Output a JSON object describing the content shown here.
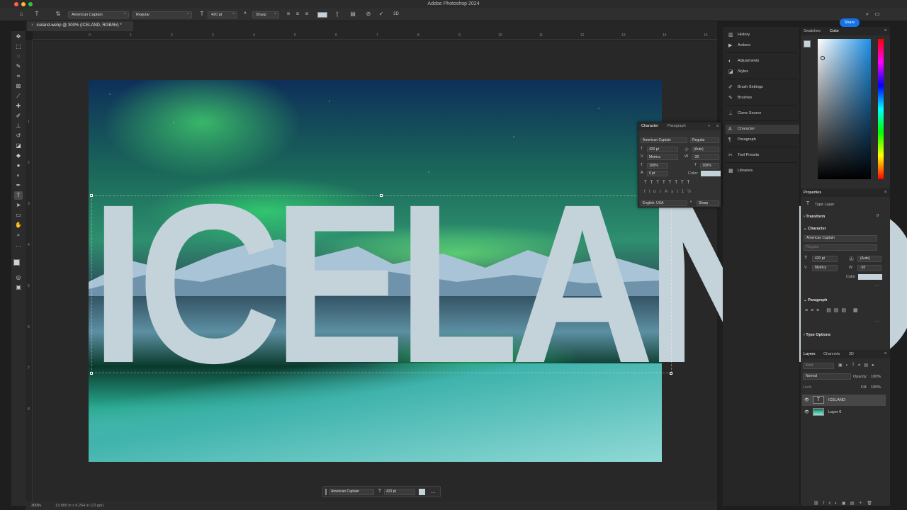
{
  "app": {
    "title": "Adobe Photoshop 2024",
    "share_label": "Share"
  },
  "options_bar": {
    "font_family": "American Captain",
    "font_style": "Regular",
    "font_size": "420 pt",
    "antialias": "Sharp"
  },
  "document": {
    "tab_label": "iceland.webp @ 300% (ICELAND, RGB/8#) *"
  },
  "canvas": {
    "text": "ICELAND"
  },
  "rulers": {
    "h": [
      "0",
      "1",
      "2",
      "3",
      "4",
      "5",
      "6",
      "7",
      "8",
      "9",
      "10",
      "11",
      "12",
      "13",
      "14",
      "15"
    ],
    "v": [
      "1",
      "2",
      "3",
      "4",
      "5",
      "6",
      "7",
      "8"
    ]
  },
  "status": {
    "zoom": "300%",
    "doc_info": "13.889 in x 8.264 in (72 ppi)"
  },
  "context_bar": {
    "font": "American Captain",
    "size": "420 pt"
  },
  "character_panel": {
    "tabs": [
      "Character",
      "Paragraph"
    ],
    "font": "American Captain",
    "style": "Regular",
    "size": "420 pt",
    "leading": "(Auto)",
    "kerning": "Metrics",
    "tracking": "-30",
    "vscale": "100%",
    "hscale": "100%",
    "baseline": "0 pt",
    "color_label": "Color:",
    "language": "English: USA",
    "antialias": "Sharp"
  },
  "dock": {
    "items": [
      "History",
      "Actions",
      "Adjustments",
      "Styles",
      "Brush Settings",
      "Brushes",
      "Clone Source",
      "Character",
      "Paragraph",
      "Tool Presets",
      "Libraries"
    ]
  },
  "swatches_panel": {
    "tabs": [
      "Swatches",
      "Color"
    ]
  },
  "properties": {
    "title": "Properties",
    "layer_type": "Type Layer",
    "transform": "Transform",
    "character": "Character",
    "font": "American Captain",
    "style": "Regular",
    "size": "420 pt",
    "leading": "(Auto)",
    "kerning": "Metrics",
    "tracking": "-30",
    "color_label": "Color",
    "paragraph": "Paragraph",
    "type_options": "Type Options"
  },
  "layers_panel": {
    "tabs": [
      "Layers",
      "Channels",
      "3D"
    ],
    "filter_placeholder": "Kind",
    "blend_mode": "Normal",
    "opacity_label": "Opacity:",
    "opacity": "100%",
    "lock_label": "Lock:",
    "fill_label": "Fill:",
    "fill": "100%",
    "layers": [
      {
        "name": "ICELAND",
        "type": "text"
      },
      {
        "name": "Layer 0",
        "type": "image"
      }
    ]
  },
  "colors": {
    "accent": "#1473e6",
    "text_color": "#c4d2da"
  }
}
